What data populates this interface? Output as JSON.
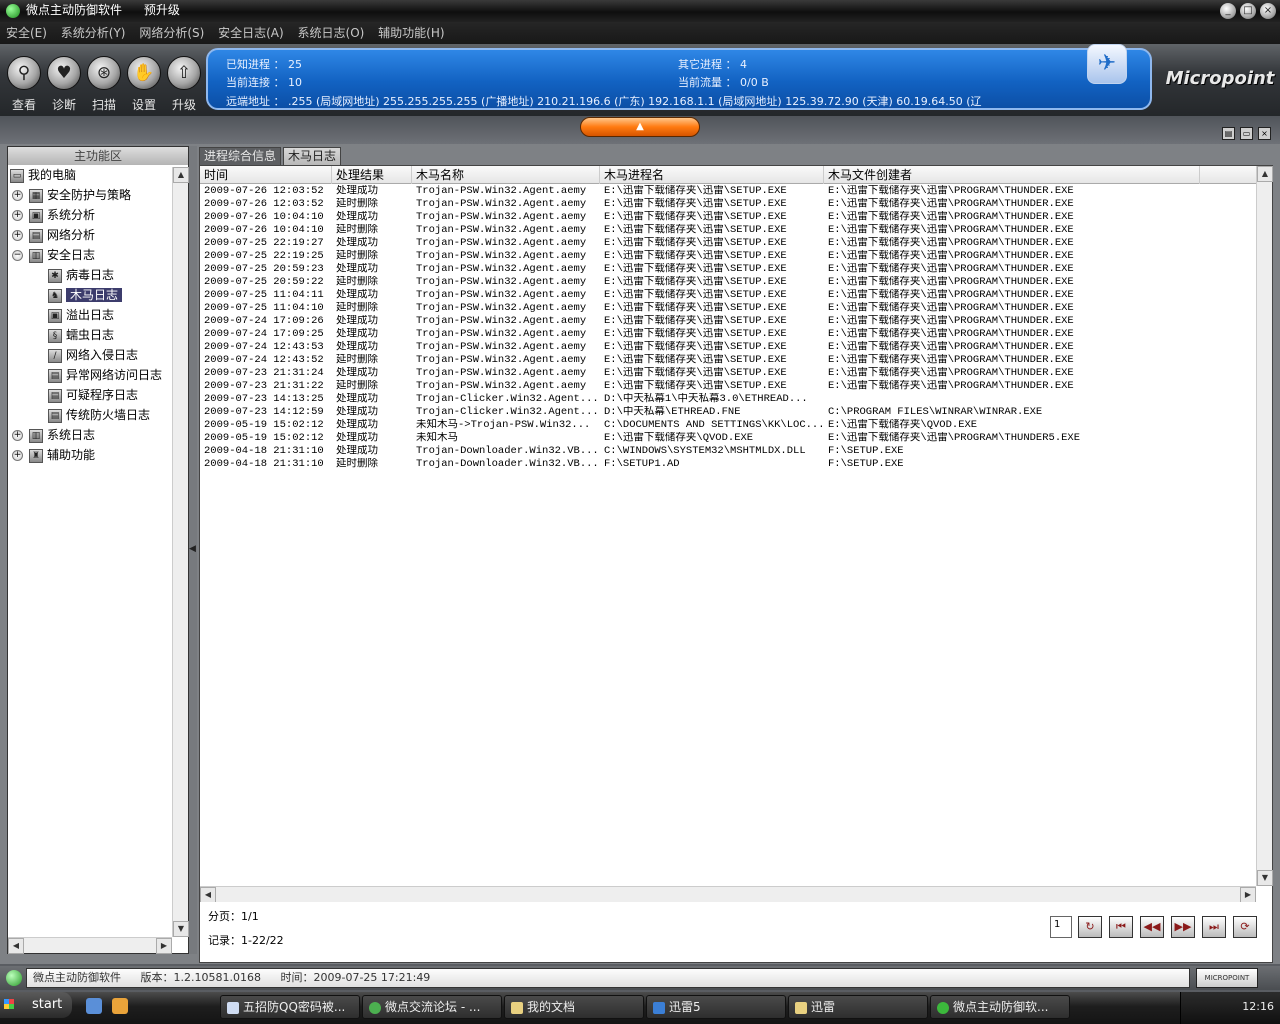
{
  "window": {
    "title": "微点主动防御软件",
    "upgrade_link": "预升级",
    "controls": [
      "_",
      "□",
      "×"
    ]
  },
  "menu": [
    "安全(E)",
    "系统分析(Y)",
    "网络分析(S)",
    "安全日志(A)",
    "系统日志(O)",
    "辅助功能(H)"
  ],
  "toolbar": {
    "buttons": [
      {
        "label": "查看",
        "icon": "magnifier-icon",
        "glyph": "⚲"
      },
      {
        "label": "诊断",
        "icon": "heart-icon",
        "glyph": "♥"
      },
      {
        "label": "扫描",
        "icon": "scan-icon",
        "glyph": "⊛"
      },
      {
        "label": "设置",
        "icon": "hand-icon",
        "glyph": "✋"
      },
      {
        "label": "升级",
        "icon": "upgrade-icon",
        "glyph": "⇧"
      }
    ]
  },
  "info": {
    "known_process": "已知进程 ： 25",
    "other_process": "其它进程 ： 4",
    "current_conn": "当前连接 ： 10",
    "current_flow": "当前流量 ： 0/0 B",
    "remote_addr": "远端地址 ：  .255 (局域网地址)     255.255.255.255 (广播地址)     210.21.196.6 (广东)     192.168.1.1 (局域网地址)     125.39.72.90 (天津)     60.19.64.50 (辽"
  },
  "brand": {
    "logo": "Micropoint",
    "status_logo": "MICROPOINT"
  },
  "tree": {
    "header": "主功能区",
    "items": [
      {
        "label": "我的电脑",
        "glyph": "▭",
        "level": 0,
        "exp": ""
      },
      {
        "label": "安全防护与策略",
        "glyph": "▦",
        "level": 1,
        "exp": "+"
      },
      {
        "label": "系统分析",
        "glyph": "▣",
        "level": 1,
        "exp": "+"
      },
      {
        "label": "网络分析",
        "glyph": "▤",
        "level": 1,
        "exp": "+"
      },
      {
        "label": "安全日志",
        "glyph": "▥",
        "level": 1,
        "exp": "−"
      },
      {
        "label": "病毒日志",
        "glyph": "✱",
        "level": 2,
        "exp": ""
      },
      {
        "label": "木马日志",
        "glyph": "♞",
        "level": 2,
        "exp": "",
        "selected": true
      },
      {
        "label": "溢出日志",
        "glyph": "▣",
        "level": 2,
        "exp": ""
      },
      {
        "label": "蠕虫日志",
        "glyph": "§",
        "level": 2,
        "exp": ""
      },
      {
        "label": "网络入侵日志",
        "glyph": "∕",
        "level": 2,
        "exp": ""
      },
      {
        "label": "异常网络访问日志",
        "glyph": "▤",
        "level": 2,
        "exp": ""
      },
      {
        "label": "可疑程序日志",
        "glyph": "▤",
        "level": 2,
        "exp": ""
      },
      {
        "label": "传统防火墙日志",
        "glyph": "▤",
        "level": 2,
        "exp": ""
      },
      {
        "label": "系统日志",
        "glyph": "▥",
        "level": 1,
        "exp": "+"
      },
      {
        "label": "辅助功能",
        "glyph": "♜",
        "level": 1,
        "exp": "+"
      }
    ]
  },
  "tabs": [
    "进程综合信息",
    "木马日志"
  ],
  "columns": [
    "时间",
    "处理结果",
    "木马名称",
    "木马进程名",
    "木马文件创建者"
  ],
  "rows": [
    [
      "2009-07-26 12:03:52",
      "处理成功",
      "Trojan-PSW.Win32.Agent.aemy",
      "E:\\迅雷下载储存夹\\迅雷\\SETUP.EXE",
      "E:\\迅雷下载储存夹\\迅雷\\PROGRAM\\THUNDER.EXE"
    ],
    [
      "2009-07-26 12:03:52",
      "延时删除",
      "Trojan-PSW.Win32.Agent.aemy",
      "E:\\迅雷下载储存夹\\迅雷\\SETUP.EXE",
      "E:\\迅雷下载储存夹\\迅雷\\PROGRAM\\THUNDER.EXE"
    ],
    [
      "2009-07-26 10:04:10",
      "处理成功",
      "Trojan-PSW.Win32.Agent.aemy",
      "E:\\迅雷下载储存夹\\迅雷\\SETUP.EXE",
      "E:\\迅雷下载储存夹\\迅雷\\PROGRAM\\THUNDER.EXE"
    ],
    [
      "2009-07-26 10:04:10",
      "延时删除",
      "Trojan-PSW.Win32.Agent.aemy",
      "E:\\迅雷下载储存夹\\迅雷\\SETUP.EXE",
      "E:\\迅雷下载储存夹\\迅雷\\PROGRAM\\THUNDER.EXE"
    ],
    [
      "2009-07-25 22:19:27",
      "处理成功",
      "Trojan-PSW.Win32.Agent.aemy",
      "E:\\迅雷下载储存夹\\迅雷\\SETUP.EXE",
      "E:\\迅雷下载储存夹\\迅雷\\PROGRAM\\THUNDER.EXE"
    ],
    [
      "2009-07-25 22:19:25",
      "延时删除",
      "Trojan-PSW.Win32.Agent.aemy",
      "E:\\迅雷下载储存夹\\迅雷\\SETUP.EXE",
      "E:\\迅雷下载储存夹\\迅雷\\PROGRAM\\THUNDER.EXE"
    ],
    [
      "2009-07-25 20:59:23",
      "处理成功",
      "Trojan-PSW.Win32.Agent.aemy",
      "E:\\迅雷下载储存夹\\迅雷\\SETUP.EXE",
      "E:\\迅雷下载储存夹\\迅雷\\PROGRAM\\THUNDER.EXE"
    ],
    [
      "2009-07-25 20:59:22",
      "延时删除",
      "Trojan-PSW.Win32.Agent.aemy",
      "E:\\迅雷下载储存夹\\迅雷\\SETUP.EXE",
      "E:\\迅雷下载储存夹\\迅雷\\PROGRAM\\THUNDER.EXE"
    ],
    [
      "2009-07-25 11:04:11",
      "处理成功",
      "Trojan-PSW.Win32.Agent.aemy",
      "E:\\迅雷下载储存夹\\迅雷\\SETUP.EXE",
      "E:\\迅雷下载储存夹\\迅雷\\PROGRAM\\THUNDER.EXE"
    ],
    [
      "2009-07-25 11:04:10",
      "延时删除",
      "Trojan-PSW.Win32.Agent.aemy",
      "E:\\迅雷下载储存夹\\迅雷\\SETUP.EXE",
      "E:\\迅雷下载储存夹\\迅雷\\PROGRAM\\THUNDER.EXE"
    ],
    [
      "2009-07-24 17:09:26",
      "处理成功",
      "Trojan-PSW.Win32.Agent.aemy",
      "E:\\迅雷下载储存夹\\迅雷\\SETUP.EXE",
      "E:\\迅雷下载储存夹\\迅雷\\PROGRAM\\THUNDER.EXE"
    ],
    [
      "2009-07-24 17:09:25",
      "处理成功",
      "Trojan-PSW.Win32.Agent.aemy",
      "E:\\迅雷下载储存夹\\迅雷\\SETUP.EXE",
      "E:\\迅雷下载储存夹\\迅雷\\PROGRAM\\THUNDER.EXE"
    ],
    [
      "2009-07-24 12:43:53",
      "处理成功",
      "Trojan-PSW.Win32.Agent.aemy",
      "E:\\迅雷下载储存夹\\迅雷\\SETUP.EXE",
      "E:\\迅雷下载储存夹\\迅雷\\PROGRAM\\THUNDER.EXE"
    ],
    [
      "2009-07-24 12:43:52",
      "延时删除",
      "Trojan-PSW.Win32.Agent.aemy",
      "E:\\迅雷下载储存夹\\迅雷\\SETUP.EXE",
      "E:\\迅雷下载储存夹\\迅雷\\PROGRAM\\THUNDER.EXE"
    ],
    [
      "2009-07-23 21:31:24",
      "处理成功",
      "Trojan-PSW.Win32.Agent.aemy",
      "E:\\迅雷下载储存夹\\迅雷\\SETUP.EXE",
      "E:\\迅雷下载储存夹\\迅雷\\PROGRAM\\THUNDER.EXE"
    ],
    [
      "2009-07-23 21:31:22",
      "延时删除",
      "Trojan-PSW.Win32.Agent.aemy",
      "E:\\迅雷下载储存夹\\迅雷\\SETUP.EXE",
      "E:\\迅雷下载储存夹\\迅雷\\PROGRAM\\THUNDER.EXE"
    ],
    [
      "2009-07-23 14:13:25",
      "处理成功",
      "Trojan-Clicker.Win32.Agent...",
      "D:\\中天私幕1\\中天私幕3.0\\ETHREAD...",
      ""
    ],
    [
      "2009-07-23 14:12:59",
      "处理成功",
      "Trojan-Clicker.Win32.Agent...",
      "D:\\中天私幕\\ETHREAD.FNE",
      "C:\\PROGRAM FILES\\WINRAR\\WINRAR.EXE"
    ],
    [
      "2009-05-19 15:02:12",
      "处理成功",
      "未知木马->Trojan-PSW.Win32...",
      "C:\\DOCUMENTS AND SETTINGS\\KK\\LOC...",
      "E:\\迅雷下载储存夹\\QVOD.EXE"
    ],
    [
      "2009-05-19 15:02:12",
      "处理成功",
      "未知木马",
      "E:\\迅雷下载储存夹\\QVOD.EXE",
      "E:\\迅雷下载储存夹\\迅雷\\PROGRAM\\THUNDER5.EXE"
    ],
    [
      "2009-04-18 21:31:10",
      "处理成功",
      "Trojan-Downloader.Win32.VB...",
      "C:\\WINDOWS\\SYSTEM32\\MSHTMLDX.DLL",
      "F:\\SETUP.EXE"
    ],
    [
      "2009-04-18 21:31:10",
      "延时删除",
      "Trojan-Downloader.Win32.VB...",
      "F:\\SETUP1.AD",
      "F:\\SETUP.EXE"
    ]
  ],
  "pager": {
    "page": "分页：1/1",
    "records": "记录：1-22/22",
    "page_input": "1"
  },
  "status": {
    "app": "微点主动防御软件",
    "version": "版本：1.2.10581.0168",
    "time": "时间：2009-07-25 17:21:49"
  },
  "taskbar": {
    "start": "start",
    "tasks": [
      "五招防QQ密码被...",
      "微点交流论坛 - ...",
      "我的文档",
      "迅雷5",
      "迅雷",
      "微点主动防御软..."
    ],
    "clock": "12:16"
  }
}
